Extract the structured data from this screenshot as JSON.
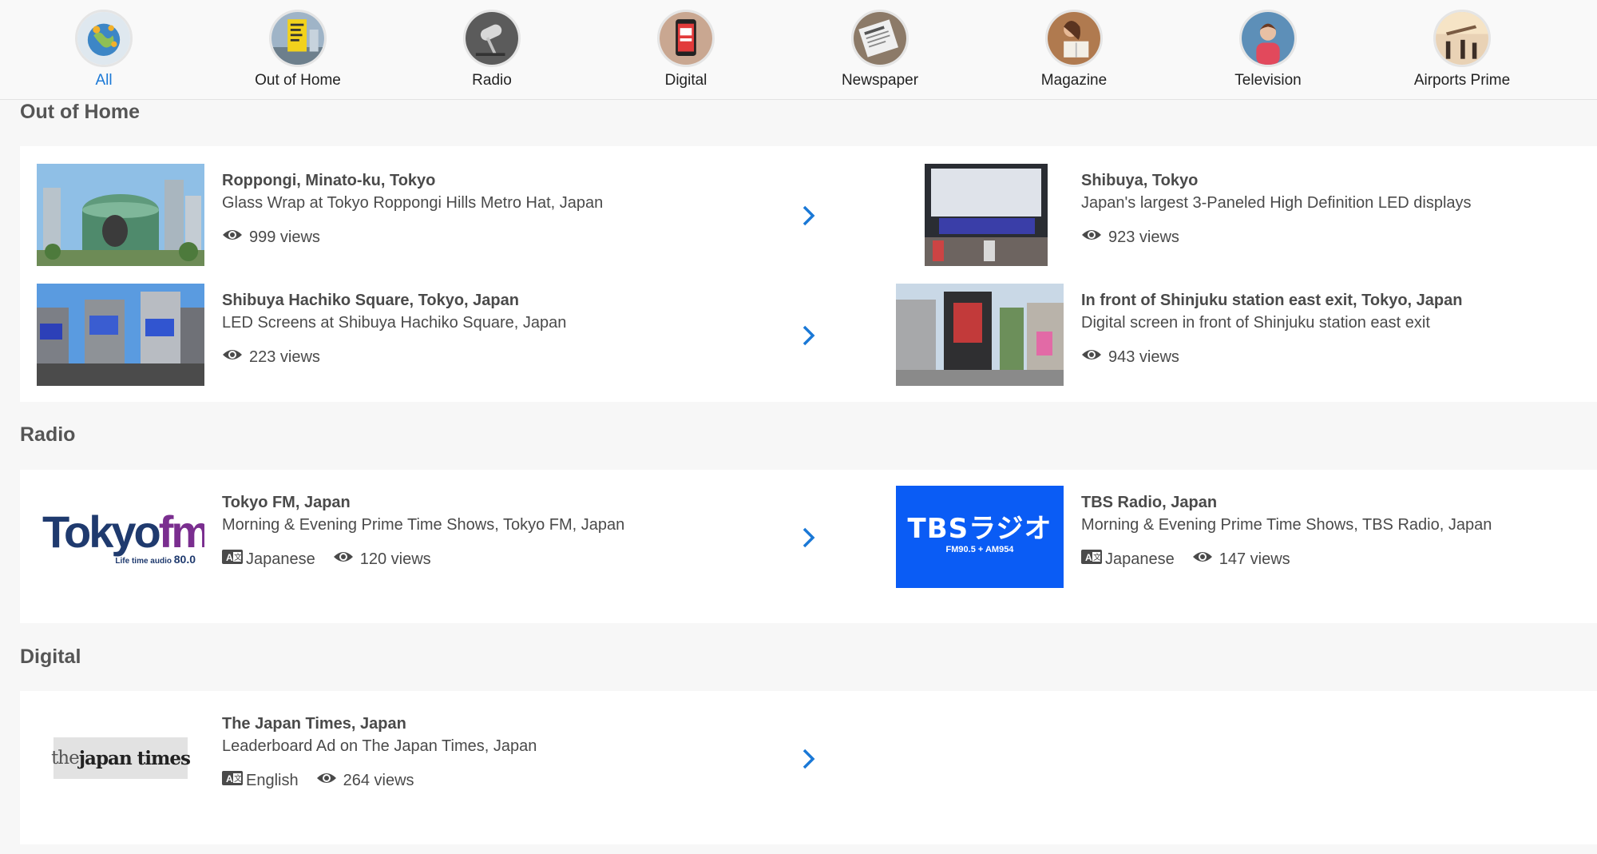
{
  "categories": [
    {
      "label": "All",
      "active": true
    },
    {
      "label": "Out of Home"
    },
    {
      "label": "Radio"
    },
    {
      "label": "Digital"
    },
    {
      "label": "Newspaper"
    },
    {
      "label": "Magazine"
    },
    {
      "label": "Television"
    },
    {
      "label": "Airports Prime"
    }
  ],
  "sections": {
    "ooh": {
      "title": "Out of Home",
      "items": [
        {
          "title": "Roppongi, Minato-ku, Tokyo",
          "desc": "Glass Wrap at Tokyo Roppongi Hills Metro Hat, Japan",
          "views": "999 views"
        },
        {
          "title": "Shibuya, Tokyo",
          "desc": "Japan's largest 3-Paneled High Definition LED displays",
          "views": "923 views"
        },
        {
          "title": "Shibuya Hachiko Square, Tokyo, Japan",
          "desc": "LED Screens at Shibuya Hachiko Square, Japan",
          "views": "223 views"
        },
        {
          "title": "In front of Shinjuku station east exit, Tokyo, Japan",
          "desc": "Digital screen in front of Shinjuku station east exit",
          "views": "943 views"
        }
      ]
    },
    "radio": {
      "title": "Radio",
      "items": [
        {
          "title": "Tokyo FM, Japan",
          "desc": "Morning & Evening Prime Time Shows, Tokyo FM, Japan",
          "language": "Japanese",
          "views": "120 views",
          "logo_main": "Tokyo",
          "logo_fm": "fm",
          "logo_tag": "Life time audio",
          "logo_freq": "80.0"
        },
        {
          "title": "TBS Radio, Japan",
          "desc": "Morning & Evening Prime Time Shows, TBS Radio, Japan",
          "language": "Japanese",
          "views": "147 views",
          "logo_main": "TBSラジオ",
          "logo_sub": "FM90.5 + AM954"
        }
      ]
    },
    "digital": {
      "title": "Digital",
      "items": [
        {
          "title": "The Japan Times, Japan",
          "desc": "Leaderboard Ad on The Japan Times, Japan",
          "language": "English",
          "views": "264 views",
          "logo_the": "the",
          "logo_main": "japan times"
        }
      ]
    }
  },
  "colors": {
    "accent": "#1a78d6",
    "tbs_blue": "#0a5cf5",
    "tokyofm_navy": "#1f3a6e",
    "tokyofm_purple": "#7a2e8f"
  },
  "icons": {
    "views": "eye-icon",
    "language": "translate-icon",
    "next": "chevron-right-icon"
  }
}
